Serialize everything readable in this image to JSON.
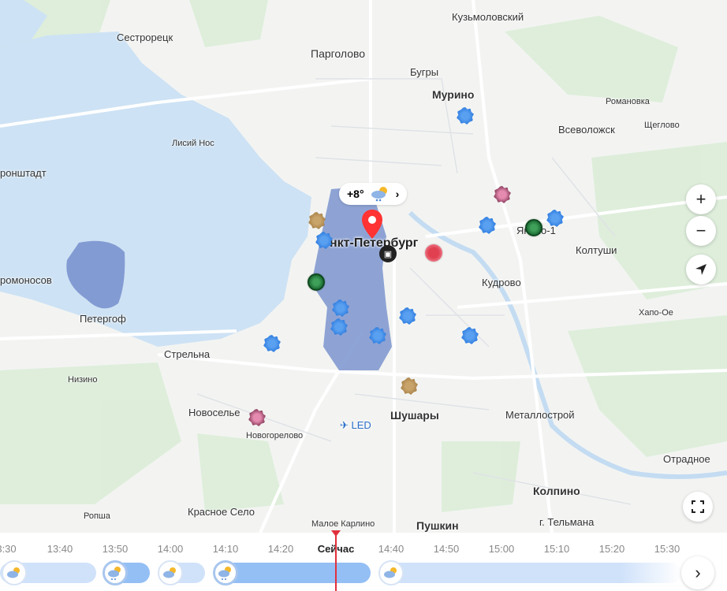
{
  "map": {
    "labels": [
      "Сестрорецк",
      "Парголово",
      "Бугры",
      "Кузьмоловский",
      "Мурино",
      "Романовка",
      "Всеволожск",
      "Щеглово",
      "Лисий Нос",
      "ронштадт",
      "Янино-1",
      "Колтуши",
      "нкт-Петербург",
      "Кудрово",
      "ромоносов",
      "Петергоф",
      "Хапо-Ое",
      "Стрельна",
      "Низино",
      "Новоселье",
      "Шушары",
      "Металлострой",
      "Новогорелово",
      "LED",
      "Отрадное",
      "Колпино",
      "Красное Село",
      "Ропша",
      "Малое Карлино",
      "Пушкин",
      "г. Тельмана"
    ],
    "weather_chip": {
      "temp": "+8°",
      "icon": "cloud-rain-sun-icon"
    }
  },
  "controls": {
    "zoom_in": "+",
    "zoom_out": "−"
  },
  "timeline": {
    "ticks": [
      "3:30",
      "13:40",
      "13:50",
      "14:00",
      "14:10",
      "14:20",
      "Сейчас",
      "14:40",
      "14:50",
      "15:00",
      "15:10",
      "15:20",
      "15:30"
    ],
    "now_label": "Сейчас",
    "accent": "#e0313b"
  }
}
